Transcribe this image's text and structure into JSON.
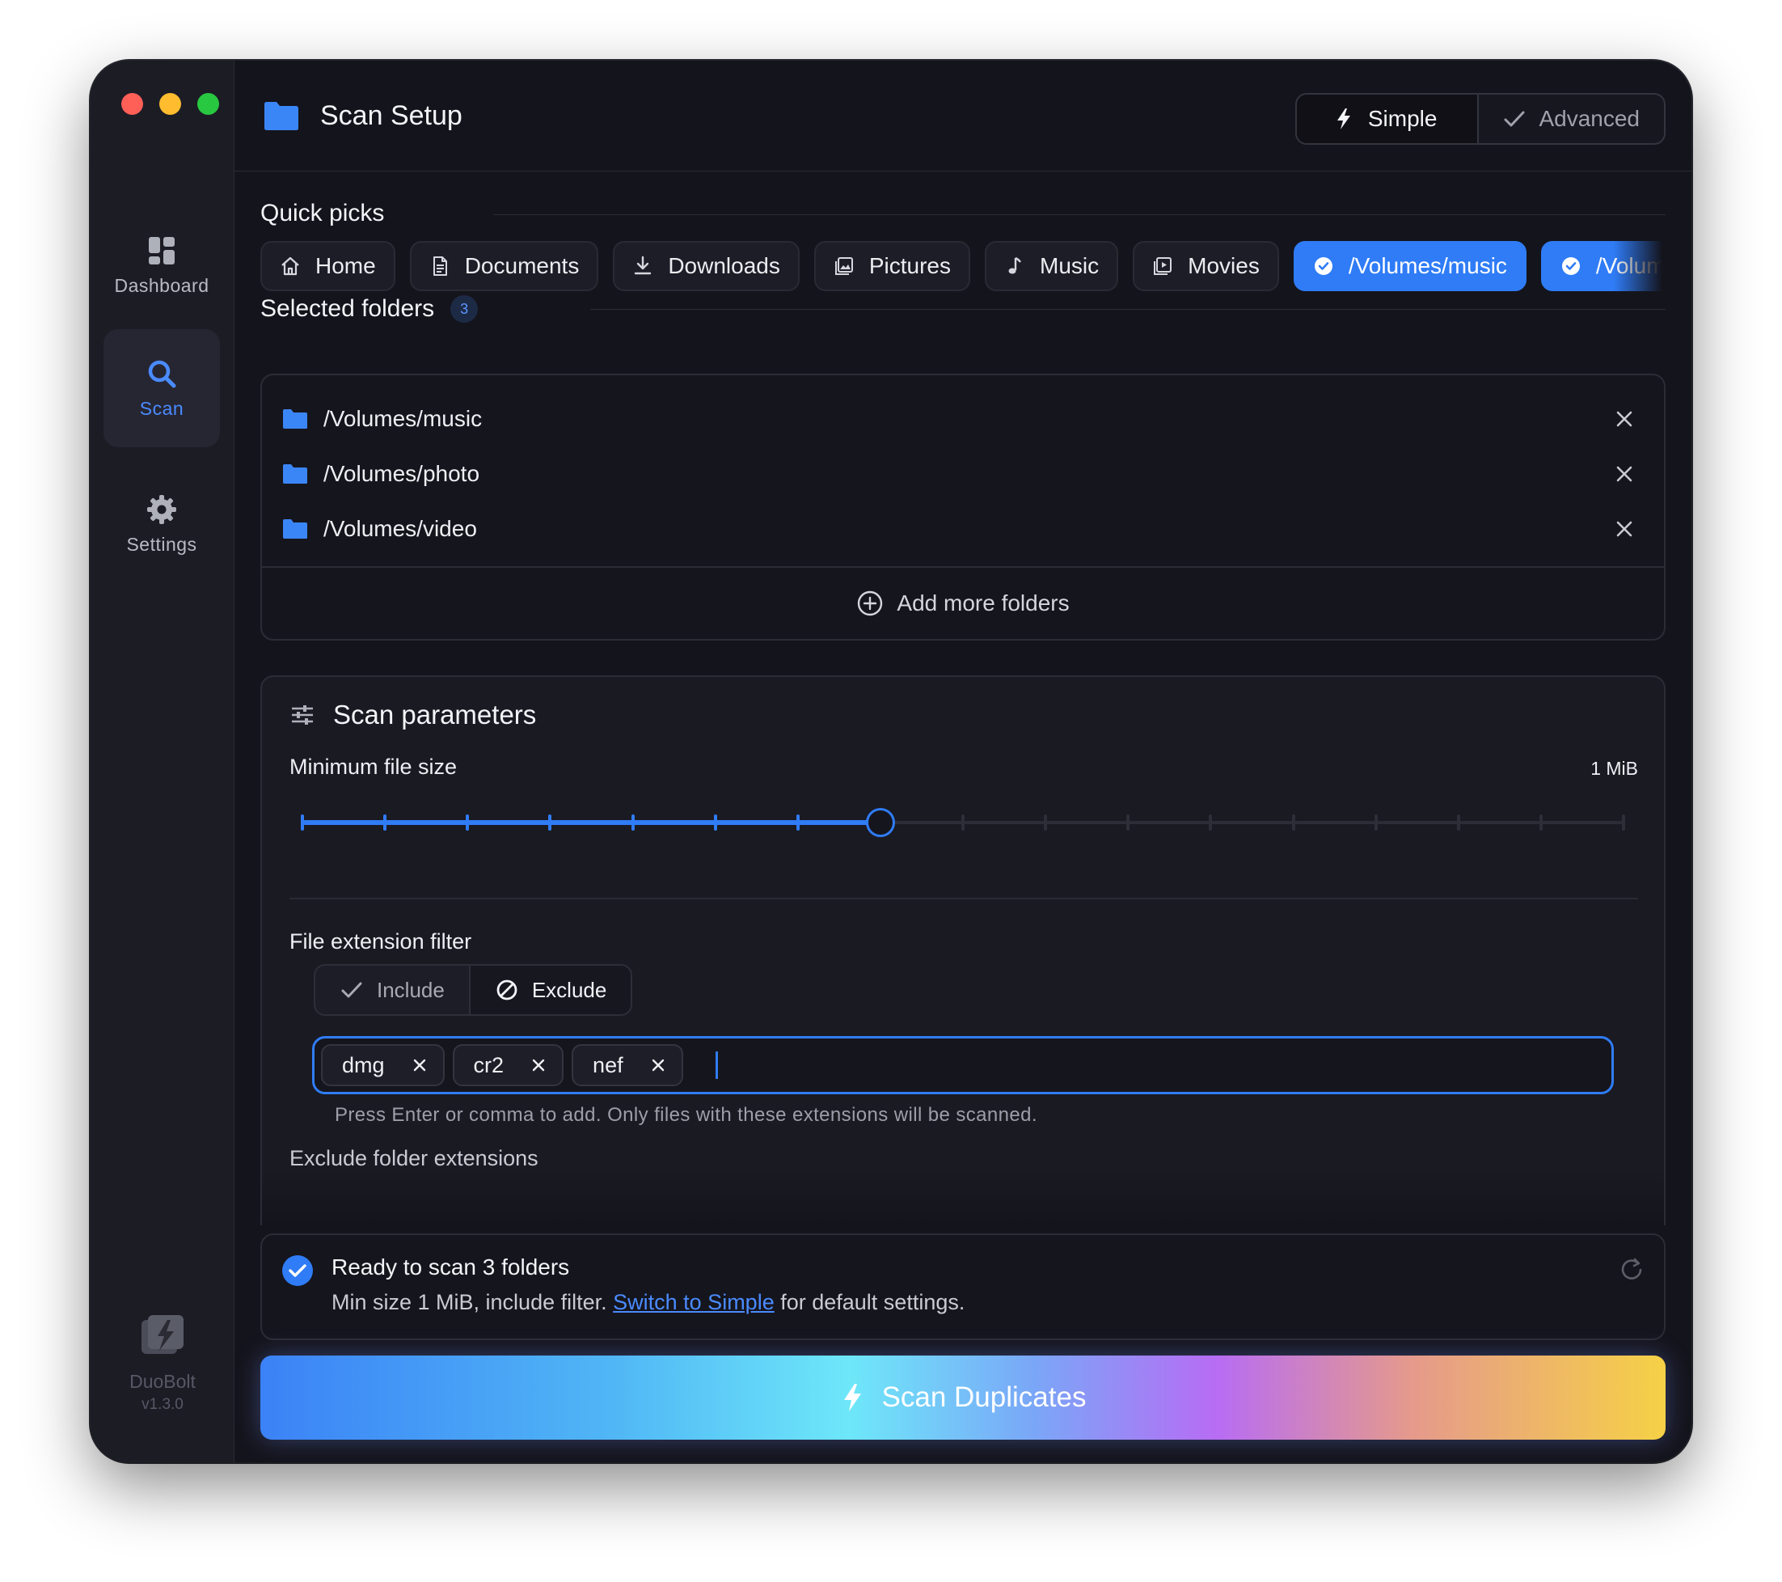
{
  "app": {
    "name": "DuoBolt",
    "version": "v1.3.0"
  },
  "sidebar": {
    "items": [
      {
        "label": "Dashboard",
        "icon": "dashboard-icon",
        "active": false
      },
      {
        "label": "Scan",
        "icon": "search-icon",
        "active": true
      },
      {
        "label": "Settings",
        "icon": "gear-icon",
        "active": false
      }
    ]
  },
  "header": {
    "title": "Scan Setup",
    "mode_simple": "Simple",
    "mode_advanced": "Advanced"
  },
  "quick_picks": {
    "title": "Quick picks",
    "chips": [
      {
        "label": "Home",
        "icon": "home-icon",
        "selected": false
      },
      {
        "label": "Documents",
        "icon": "document-icon",
        "selected": false
      },
      {
        "label": "Downloads",
        "icon": "download-icon",
        "selected": false
      },
      {
        "label": "Pictures",
        "icon": "pictures-icon",
        "selected": false
      },
      {
        "label": "Music",
        "icon": "music-icon",
        "selected": false
      },
      {
        "label": "Movies",
        "icon": "movies-icon",
        "selected": false
      },
      {
        "label": "/Volumes/music",
        "icon": "check-circle-icon",
        "selected": true
      },
      {
        "label": "/Volumes/photo",
        "icon": "check-circle-icon",
        "selected": true
      }
    ]
  },
  "selected_folders": {
    "title": "Selected folders",
    "count": "3",
    "items": [
      "/Volumes/music",
      "/Volumes/photo",
      "/Volumes/video"
    ],
    "add_more": "Add more folders"
  },
  "scan_parameters": {
    "title": "Scan parameters",
    "min_size_label": "Minimum file size",
    "min_size_value": "1 MiB",
    "slider_steps": 17,
    "slider_index": 7,
    "ext_filter_label": "File extension filter",
    "include_label": "Include",
    "exclude_label": "Exclude",
    "tags": [
      "dmg",
      "cr2",
      "nef"
    ],
    "hint": "Press Enter or comma to add. Only files with these extensions will be scanned.",
    "exclude_folder_label": "Exclude folder extensions"
  },
  "status": {
    "heading": "Ready to scan 3 folders",
    "sub_prefix": "Min size 1 MiB, include filter. ",
    "link": "Switch to Simple",
    "sub_suffix": " for default settings."
  },
  "scan_button": "Scan Duplicates",
  "colors": {
    "accent": "#2f7cf6",
    "window_bg": "#14141c",
    "sidebar_bg": "#1c1c25"
  }
}
